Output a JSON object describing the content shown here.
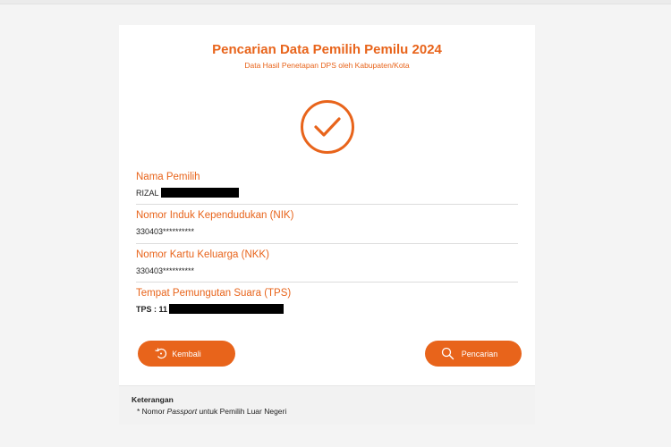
{
  "header": {
    "title": "Pencarian Data Pemilih Pemilu 2024",
    "subtitle": "Data Hasil Penetapan DPS oleh Kabupaten/Kota"
  },
  "fields": [
    {
      "label": "Nama Pemilih",
      "value": "RIZAL"
    },
    {
      "label": "Nomor Induk Kependudukan (NIK)",
      "value": "330403**********"
    },
    {
      "label": "Nomor Kartu Keluarga (NKK)",
      "value": "330403**********"
    },
    {
      "label": "Tempat Pemungutan Suara (TPS)",
      "value": "TPS : 11"
    }
  ],
  "buttons": {
    "back_label": "Kembali",
    "search_label": "Pencarian"
  },
  "footer": {
    "heading": "Keterangan",
    "note_prefix": "* Nomor ",
    "note_italic": "Passport",
    "note_suffix": " untuk Pemilih Luar Negeri"
  },
  "colors": {
    "accent": "#e8641b"
  },
  "icons": {
    "status": "check-circle-icon",
    "back": "back-arrow-icon",
    "search": "search-icon"
  }
}
